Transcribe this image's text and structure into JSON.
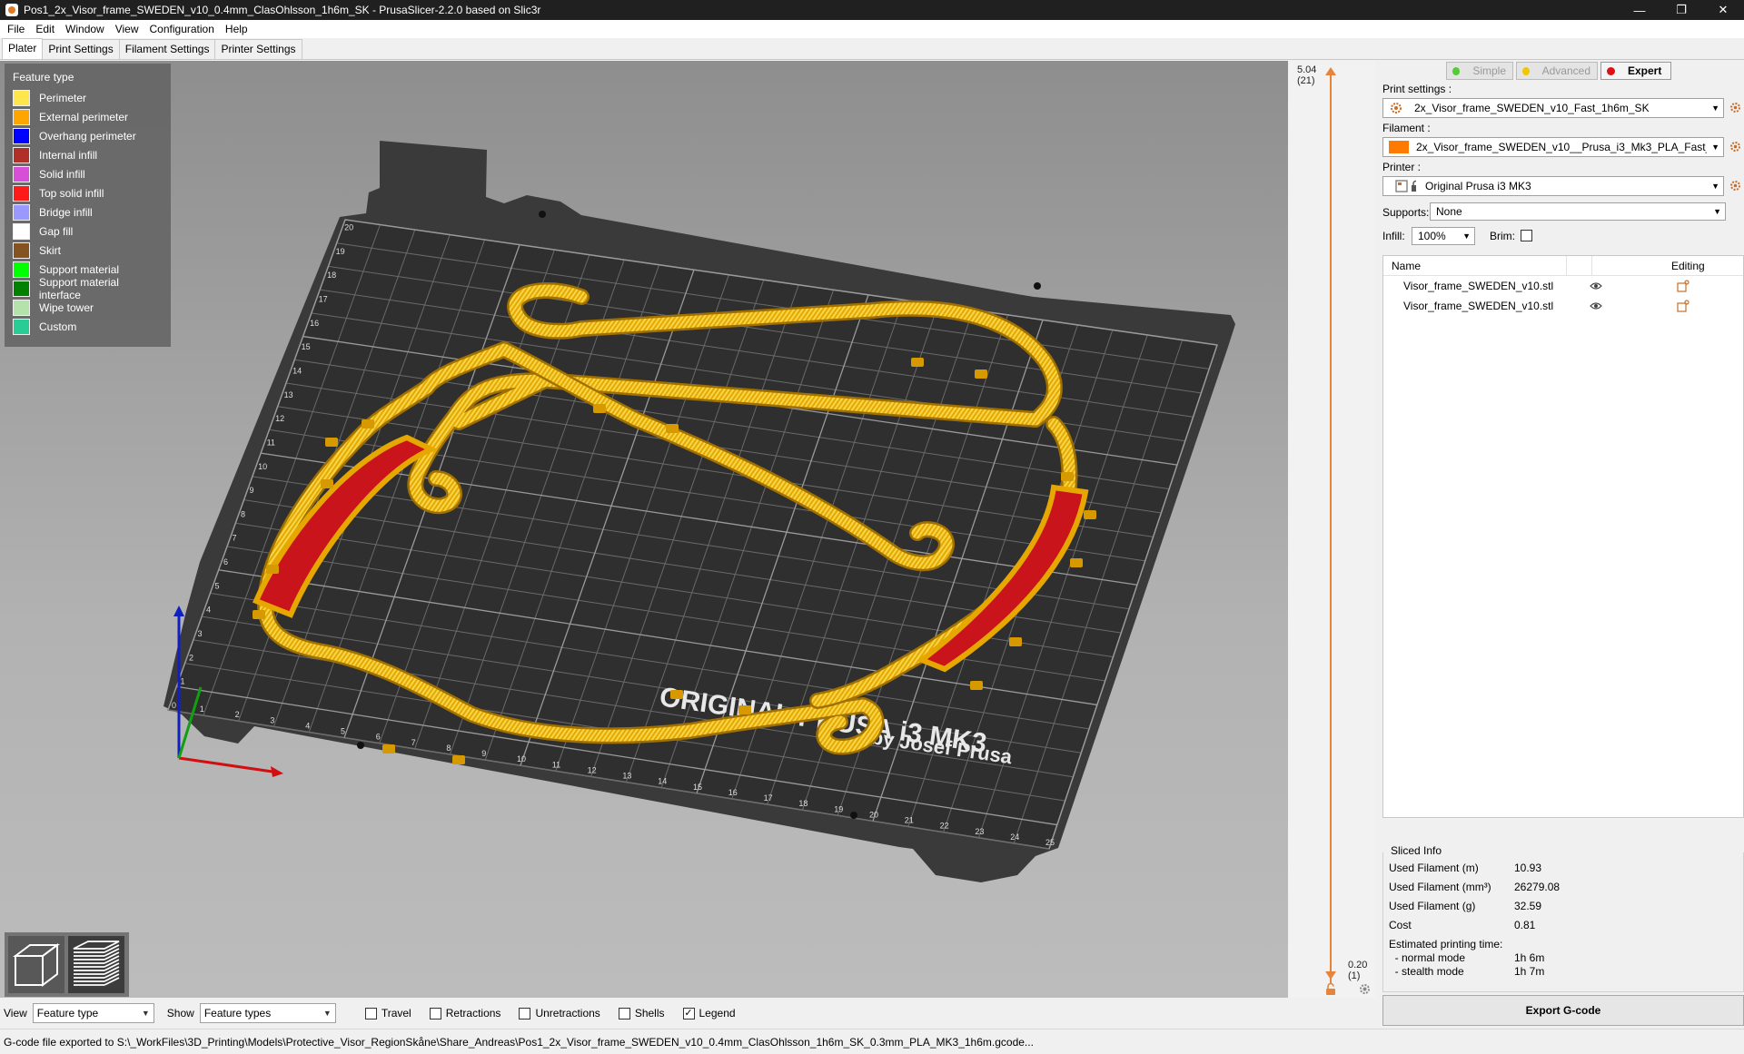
{
  "window": {
    "title": "Pos1_2x_Visor_frame_SWEDEN_v10_0.4mm_ClasOhlsson_1h6m_SK - PrusaSlicer-2.2.0 based on Slic3r",
    "minimize": "—",
    "maximize": "❐",
    "close": "✕"
  },
  "menu": [
    "File",
    "Edit",
    "Window",
    "View",
    "Configuration",
    "Help"
  ],
  "tabs": [
    "Plater",
    "Print Settings",
    "Filament Settings",
    "Printer Settings"
  ],
  "legend": {
    "title": "Feature type",
    "items": [
      {
        "label": "Perimeter",
        "color": "#ffe64d"
      },
      {
        "label": "External perimeter",
        "color": "#ffa500"
      },
      {
        "label": "Overhang perimeter",
        "color": "#0000ff"
      },
      {
        "label": "Internal infill",
        "color": "#b03029"
      },
      {
        "label": "Solid infill",
        "color": "#d64fd6"
      },
      {
        "label": "Top solid infill",
        "color": "#ff1a1a"
      },
      {
        "label": "Bridge infill",
        "color": "#9999ff"
      },
      {
        "label": "Gap fill",
        "color": "#ffffff"
      },
      {
        "label": "Skirt",
        "color": "#845321"
      },
      {
        "label": "Support material",
        "color": "#00ff00"
      },
      {
        "label": "Support material interface",
        "color": "#008000"
      },
      {
        "label": "Wipe tower",
        "color": "#b3e3ab"
      },
      {
        "label": "Custom",
        "color": "#28cc94"
      }
    ]
  },
  "bed": {
    "logo_line1": "ORIGINAL PRUSA i3  MK3",
    "logo_line2": "by Josef Prusa",
    "x_ticks": [
      "1",
      "2",
      "3",
      "4",
      "5",
      "6",
      "7",
      "8",
      "9",
      "10",
      "11",
      "12",
      "13",
      "14",
      "15",
      "16",
      "17",
      "18",
      "19",
      "20",
      "21",
      "22",
      "23",
      "24",
      "25"
    ],
    "y_ticks": [
      "0",
      "1",
      "2",
      "3",
      "4",
      "5",
      "6",
      "7",
      "8",
      "9",
      "10",
      "11",
      "12",
      "13",
      "14",
      "15",
      "16",
      "17",
      "18",
      "19",
      "20"
    ]
  },
  "layer_slider": {
    "top_height": "5.04",
    "top_layer": "(21)",
    "bottom_height": "0.20",
    "bottom_layer": "(1)"
  },
  "bottom_bar": {
    "view_label": "View",
    "view_value": "Feature type",
    "show_label": "Show",
    "show_value": "Feature types",
    "checkboxes": [
      {
        "label": "Travel",
        "checked": false
      },
      {
        "label": "Retractions",
        "checked": false
      },
      {
        "label": "Unretractions",
        "checked": false
      },
      {
        "label": "Shells",
        "checked": false
      },
      {
        "label": "Legend",
        "checked": true
      }
    ]
  },
  "status": "G-code file exported to S:\\_WorkFiles\\3D_Printing\\Models\\Protective_Visor_RegionSkåne\\Share_Andreas\\Pos1_2x_Visor_frame_SWEDEN_v10_0.4mm_ClasOhlsson_1h6m_SK_0.3mm_PLA_MK3_1h6m.gcode...",
  "sidebar": {
    "modes": [
      {
        "label": "Simple",
        "color": "#55cc33",
        "active": false
      },
      {
        "label": "Advanced",
        "color": "#f0c800",
        "active": false
      },
      {
        "label": "Expert",
        "color": "#dd1111",
        "active": true
      }
    ],
    "print_settings_label": "Print settings :",
    "print_settings_value": "2x_Visor_frame_SWEDEN_v10_Fast_1h6m_SK",
    "filament_label": "Filament :",
    "filament_value": "2x_Visor_frame_SWEDEN_v10__Prusa_i3_Mk3_PLA_Fast_",
    "filament_color": "#ff7a00",
    "printer_label": "Printer :",
    "printer_value": "Original Prusa i3 MK3",
    "supports_label": "Supports:",
    "supports_value": "None",
    "infill_label": "Infill:",
    "infill_value": "100%",
    "brim_label": "Brim:",
    "list_header_name": "Name",
    "list_header_editing": "Editing",
    "objects": [
      "Visor_frame_SWEDEN_v10.stl",
      "Visor_frame_SWEDEN_v10.stl"
    ],
    "sliced_info": {
      "title": "Sliced Info",
      "rows": [
        {
          "label": "Used Filament (m)",
          "value": "10.93"
        },
        {
          "label": "Used Filament (mm³)",
          "value": "26279.08"
        },
        {
          "label": "Used Filament (g)",
          "value": "32.59"
        },
        {
          "label": "Cost",
          "value": "0.81"
        },
        {
          "label": "Estimated printing time:",
          "value": ""
        },
        {
          "label": "  - normal mode",
          "value": "1h 6m"
        },
        {
          "label": "  - stealth mode",
          "value": "1h 7m"
        }
      ]
    },
    "export_label": "Export G-code"
  }
}
